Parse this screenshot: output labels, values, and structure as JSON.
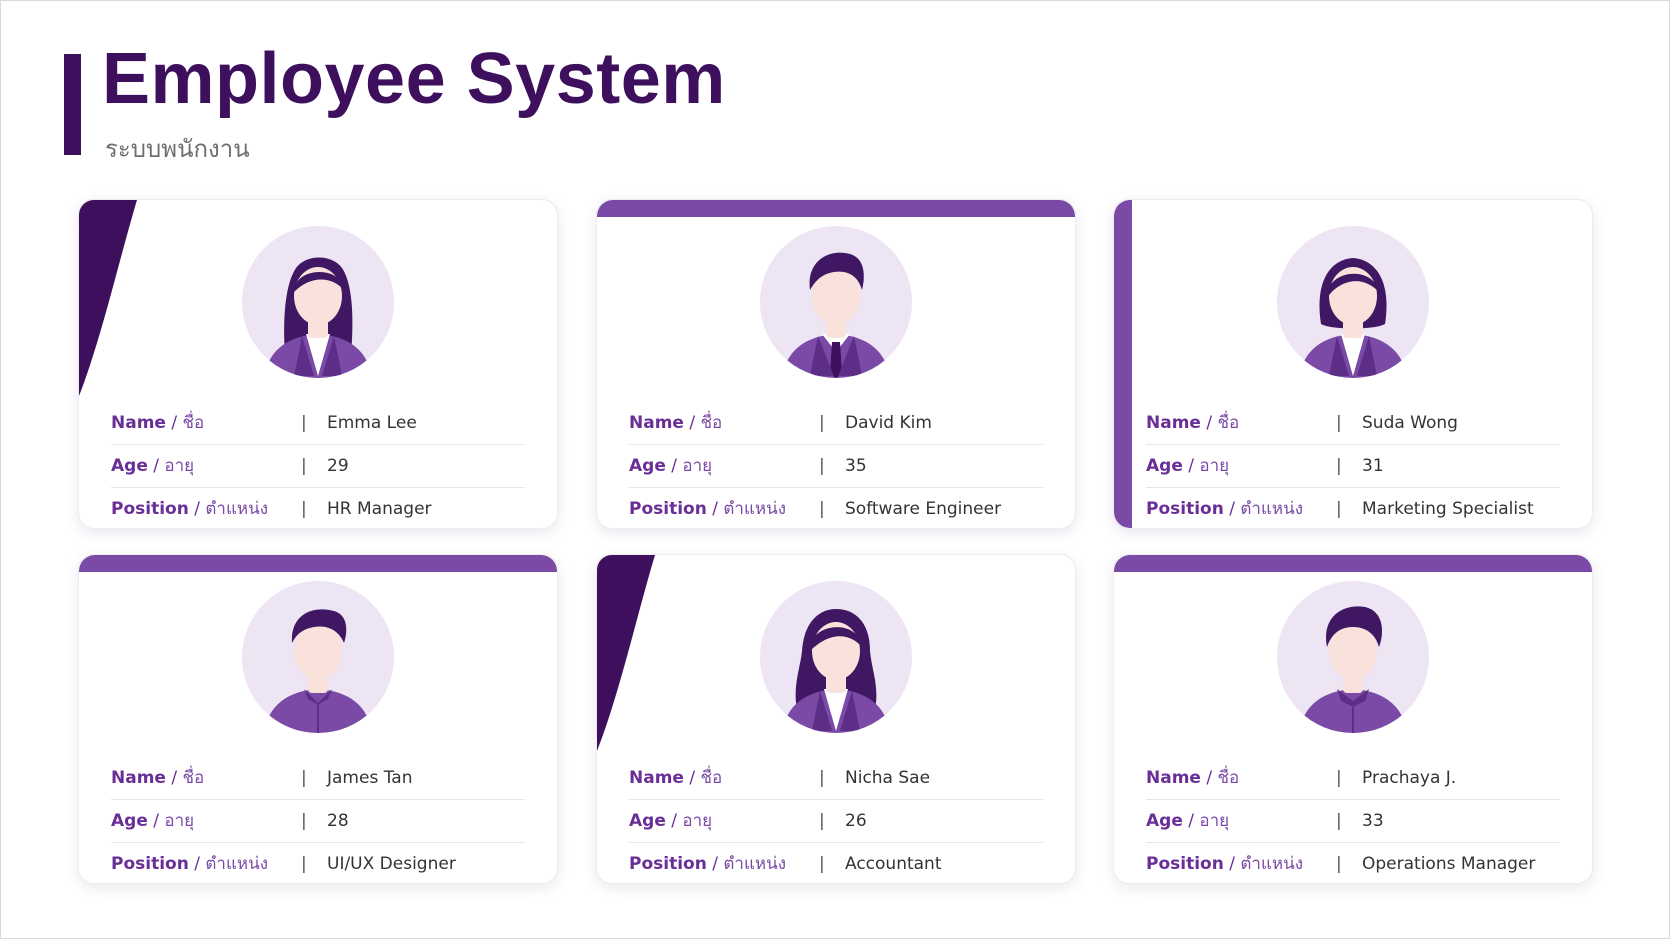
{
  "header": {
    "title": "Employee System",
    "subtitle": "ระบบพนักงาน"
  },
  "labels": {
    "name_en": "Name",
    "name_th": "ชื่อ",
    "age_en": "Age",
    "age_th": "อายุ",
    "position_en": "Position",
    "position_th": "ตำแหน่ง",
    "slash": "/",
    "separator": "|"
  },
  "colors": {
    "brand_dark": "#3d0f5c",
    "brand": "#7a4aa6",
    "avatar_bg": "#eee5f4"
  },
  "employees": [
    {
      "name": "Emma Lee",
      "age": "29",
      "position": "HR Manager",
      "decor": "swoosh",
      "avatar": "female-long-hair"
    },
    {
      "name": "David Kim",
      "age": "35",
      "position": "Software Engineer",
      "decor": "top-bar",
      "avatar": "male-tie"
    },
    {
      "name": "Suda Wong",
      "age": "31",
      "position": "Marketing Specialist",
      "decor": "left-bar",
      "avatar": "female-bob"
    },
    {
      "name": "James Tan",
      "age": "28",
      "position": "UI/UX Designer",
      "decor": "top-bar",
      "avatar": "male-shirt"
    },
    {
      "name": "Nicha Sae",
      "age": "26",
      "position": "Accountant",
      "decor": "swoosh",
      "avatar": "female-wavy"
    },
    {
      "name": "Prachaya J.",
      "age": "33",
      "position": "Operations Manager",
      "decor": "top-bar",
      "avatar": "male-collar"
    }
  ]
}
